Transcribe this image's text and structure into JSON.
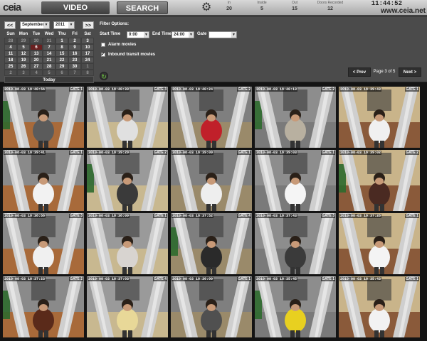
{
  "topbar": {
    "logo": "ceia",
    "video_label": "VIDEO",
    "search_label": "SEARCH",
    "counters": [
      {
        "label": "In",
        "value": "20"
      },
      {
        "label": "Inside",
        "value": "5"
      },
      {
        "label": "Out",
        "value": "15"
      },
      {
        "label": "Doors Recorded",
        "value": "12"
      }
    ],
    "clock": "11:44:52",
    "site": "www.ceia.net"
  },
  "calendar": {
    "prev": "<<",
    "next": ">>",
    "month": "September",
    "year": "2011",
    "days": [
      "Sun",
      "Mon",
      "Tue",
      "Wed",
      "Thu",
      "Fri",
      "Sat"
    ],
    "weeks": [
      [
        "28",
        "29",
        "30",
        "31",
        "1",
        "2",
        "3"
      ],
      [
        "4",
        "5",
        "6",
        "7",
        "8",
        "9",
        "10"
      ],
      [
        "11",
        "12",
        "13",
        "14",
        "15",
        "16",
        "17"
      ],
      [
        "18",
        "19",
        "20",
        "21",
        "22",
        "23",
        "24"
      ],
      [
        "25",
        "26",
        "27",
        "28",
        "29",
        "30",
        "1"
      ],
      [
        "2",
        "3",
        "4",
        "5",
        "6",
        "7",
        "8"
      ]
    ],
    "today_label": "Today"
  },
  "filters": {
    "title": "Filter Options:",
    "start_label": "Start Time",
    "start_value": "0:00",
    "end_label": "End Time",
    "end_value": "24:00",
    "gate_label": "Gate",
    "gate_value": "",
    "alarm_label": "Alarm movies",
    "alarm_checked": false,
    "inbound_label": "Inbound transit movies",
    "inbound_checked": true
  },
  "pager": {
    "prev": "< Prev",
    "info": "Page 3 of 5",
    "next": "Next >"
  },
  "thumbnails": [
    {
      "time": "2010-08-03 18:40:56",
      "gate": "GATE 1",
      "shirt": "#5b5b5b"
    },
    {
      "time": "2010-08-03 18:40:33",
      "gate": "GATE 3",
      "shirt": "#e0e0e0"
    },
    {
      "time": "2010-08-03 18:40:24",
      "gate": "GATE 2",
      "shirt": "#c0202a"
    },
    {
      "time": "2010-08-03 18:40:13",
      "gate": "GATE 2",
      "shirt": "#b8b0a0"
    },
    {
      "time": "2010-08-03 18:39:43",
      "gate": "GATE 1",
      "shirt": "#f0f0f0"
    },
    {
      "time": "2010-08-03 18:39:41",
      "gate": "GATE 1",
      "shirt": "#f2f2f2"
    },
    {
      "time": "2010-08-03 18:39:29",
      "gate": "GATE 2",
      "shirt": "#3a3a3a"
    },
    {
      "time": "2010-08-03 18:39:09",
      "gate": "GATE 1",
      "shirt": "#eeeeee"
    },
    {
      "time": "2010-08-03 18:39:03",
      "gate": "GATE 1",
      "shirt": "#f5f5f5"
    },
    {
      "time": "2010-08-03 18:39:02",
      "gate": "GATE 2",
      "shirt": "#4a2a22"
    },
    {
      "time": "2010-08-03 18:38:58",
      "gate": "GATE 3",
      "shirt": "#f0f0f0"
    },
    {
      "time": "2010-08-03 18:38:09",
      "gate": "GATE 1",
      "shirt": "#d8d4d0"
    },
    {
      "time": "2010-08-03 18:37:52",
      "gate": "GATE 4",
      "shirt": "#2a2a2a"
    },
    {
      "time": "2010-08-03 18:37:43",
      "gate": "GATE 3",
      "shirt": "#3a3a3a"
    },
    {
      "time": "2010-08-03 18:37:28",
      "gate": "GATE 1",
      "shirt": "#f4f4f4"
    },
    {
      "time": "2010-08-03 18:37:23",
      "gate": "GATE 2",
      "shirt": "#5a2a1a"
    },
    {
      "time": "2010-08-03 18:37:03",
      "gate": "GATE 4",
      "shirt": "#e8d898"
    },
    {
      "time": "2010-08-03 18:36:00",
      "gate": "GATE 1",
      "shirt": "#505050"
    },
    {
      "time": "2010-08-03 18:35:45",
      "gate": "GATE 1",
      "shirt": "#e8d020"
    },
    {
      "time": "2010-08-03 18:35:43",
      "gate": "GATE 1",
      "shirt": "#f2f2f2"
    }
  ]
}
